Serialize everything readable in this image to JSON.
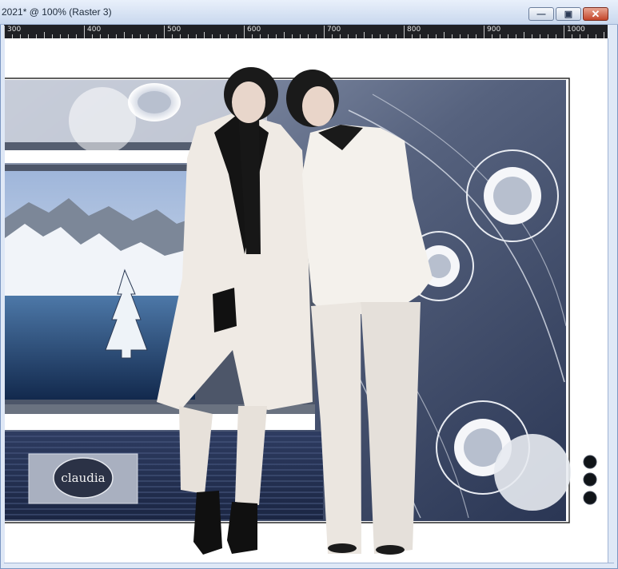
{
  "window": {
    "title": "2021* @ 100% (Raster 3)",
    "buttons": {
      "minimize": "—",
      "maximize": "▣",
      "close": "✕"
    }
  },
  "ruler": {
    "labels": [
      "300",
      "400",
      "500",
      "600",
      "700",
      "800",
      "900",
      "1000"
    ]
  },
  "artwork": {
    "watermark": "claudia",
    "colors": {
      "navy": "#2b3a5a",
      "steel": "#6b7894",
      "light": "#e6e9ef",
      "cream": "#f2eee9",
      "black": "#121212"
    }
  }
}
